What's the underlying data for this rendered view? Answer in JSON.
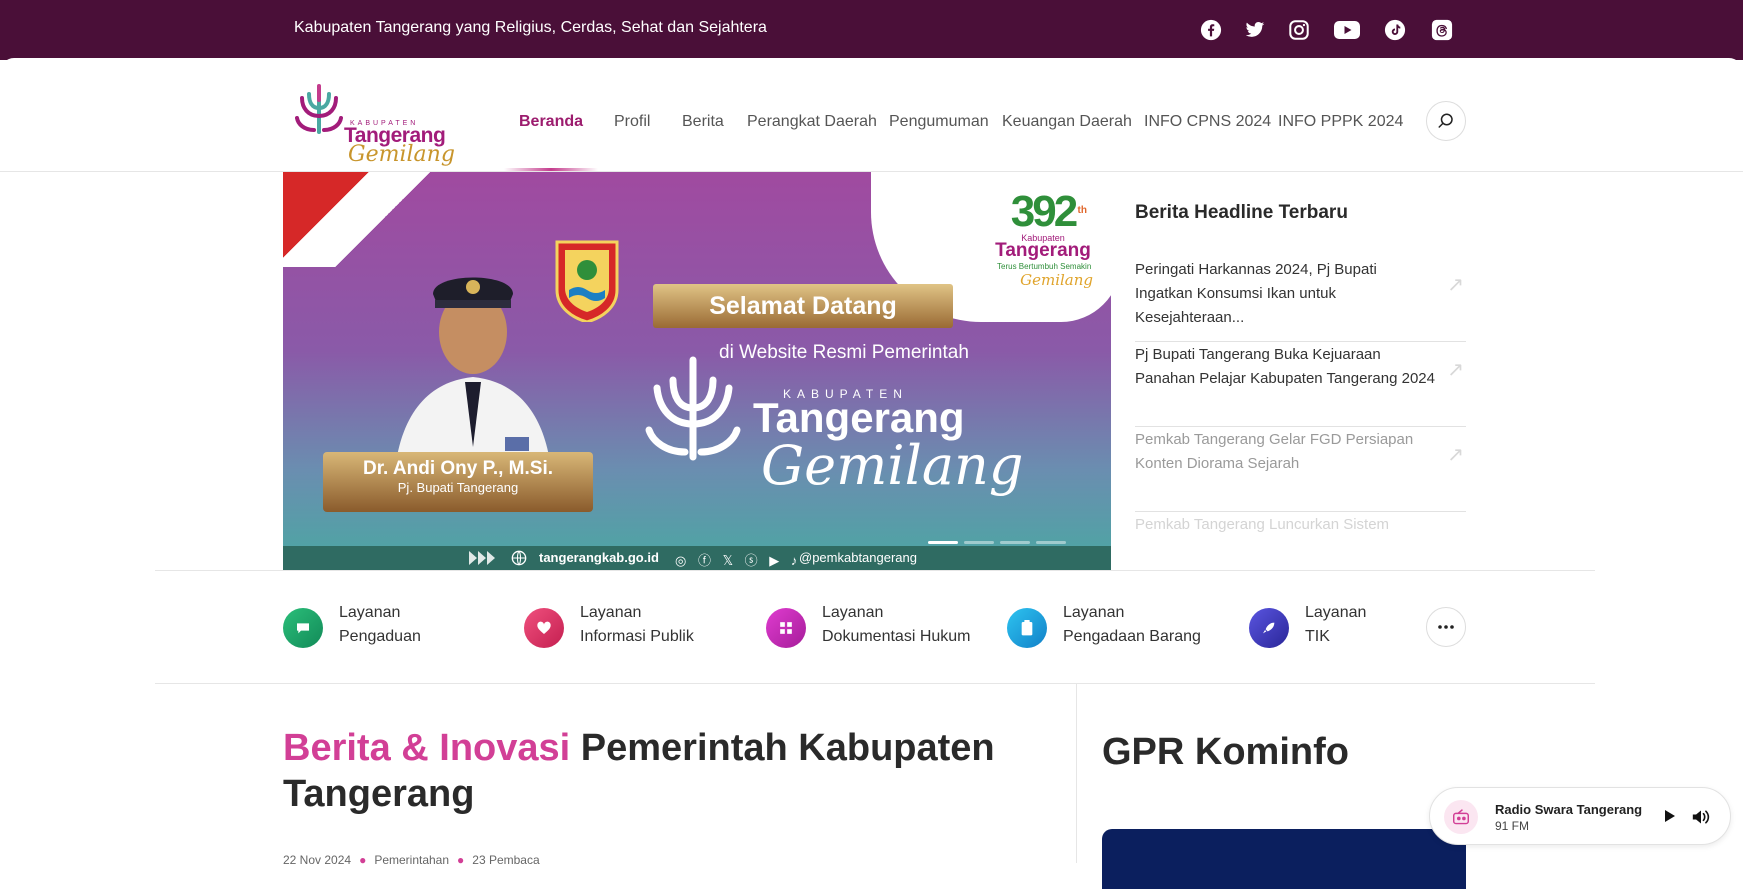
{
  "topbar": {
    "tagline": "Kabupaten Tangerang yang Religius, Cerdas, Sehat dan Sejahtera",
    "background": "#4a0f38",
    "social_icons": [
      "facebook-icon",
      "twitter-icon",
      "instagram-icon",
      "youtube-icon",
      "tiktok-icon",
      "threads-icon"
    ]
  },
  "logo": {
    "kabupaten": "KABUPATEN",
    "tangerang": "Tangerang",
    "gemilang": "Gemilang"
  },
  "nav": {
    "items": [
      "Beranda",
      "Profil",
      "Berita",
      "Perangkat Daerah",
      "Pengumuman",
      "Keuangan Daerah",
      "INFO CPNS 2024",
      "INFO PPPK 2024"
    ],
    "active": "Beranda",
    "accent": "#9c1c6e"
  },
  "hero": {
    "welcome": "Selamat Datang",
    "subline": "di Website Resmi Pemerintah",
    "brand_kabupaten": "KABUPATEN",
    "brand_tangerang": "Tangerang",
    "brand_gemilang": "Gemilang",
    "official_name": "Dr. Andi Ony P., M.Si.",
    "official_role": "Pj. Bupati Tangerang",
    "anniversary_number": "392",
    "anniversary_suffix": "th",
    "anniversary_kabupaten": "Kabupaten",
    "anniversary_tangerang": "Tangerang",
    "anniversary_slogan": "Terus Bertumbuh Semakin",
    "anniversary_gemilang": "Gemilang",
    "footer_site": "tangerangkab.go.id",
    "footer_handle": "@pemkabtangerang",
    "slides_total": 4,
    "slide_active": 1
  },
  "headlines": {
    "title": "Berita Headline Terbaru",
    "items": [
      "Peringati Harkannas 2024, Pj Bupati Ingatkan Konsumsi Ikan untuk Kesejahteraan...",
      "Pj Bupati Tangerang Buka Kejuaraan Panahan Pelajar Kabupaten Tangerang 2024",
      "Pemkab Tangerang Gelar FGD Persiapan Konten Diorama Sejarah",
      "Pemkab Tangerang Luncurkan Sistem"
    ]
  },
  "services": [
    {
      "line1": "Layanan",
      "line2": "Pengaduan",
      "color": "#1fa36a",
      "icon": "chat-icon"
    },
    {
      "line1": "Layanan",
      "line2": "Informasi Publik",
      "color": "#e0356a",
      "icon": "heart-icon"
    },
    {
      "line1": "Layanan",
      "line2": "Dokumentasi Hukum",
      "color": "#c427b6",
      "icon": "grid-icon"
    },
    {
      "line1": "Layanan",
      "line2": "Pengadaan Barang",
      "color": "#1b9fe0",
      "icon": "clipboard-icon"
    },
    {
      "line1": "Layanan",
      "line2": "TIK",
      "color": "#3a35b8",
      "icon": "rocket-icon"
    }
  ],
  "news": {
    "title_accent": "Berita & Inovasi",
    "title_rest": "Pemerintah Kabupaten Tangerang",
    "date": "22 Nov 2024",
    "category": "Pemerintahan",
    "reads": "23 Pembaca"
  },
  "gpr": {
    "title": "GPR Kominfo"
  },
  "radio": {
    "name": "Radio Swara Tangerang",
    "frequency": "91 FM"
  }
}
